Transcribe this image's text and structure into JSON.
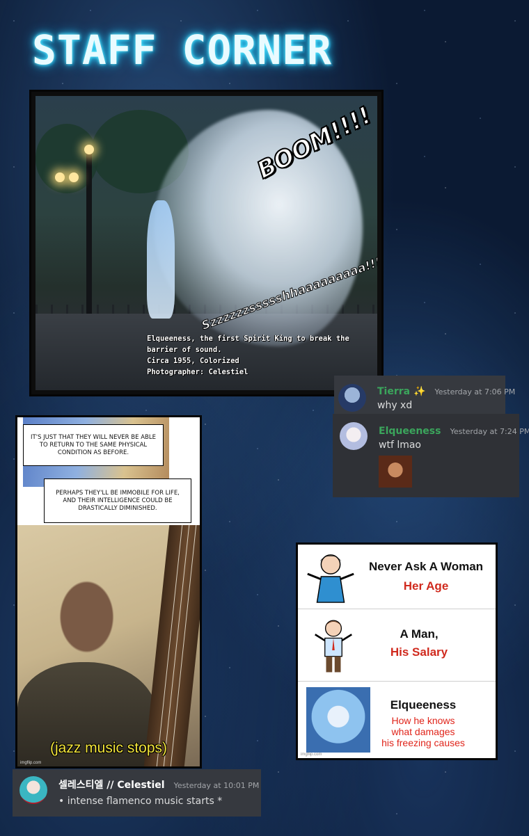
{
  "page": {
    "title": "STAFF CORNER"
  },
  "photo_panel": {
    "sfx_boom": "BOOM!!!!",
    "sfx_whoosh": "Szzzzzzssssshhaaaaaaaaa!!!~",
    "caption_line1": "Elqueeness, the first Spirit King to break the barrier of sound.",
    "caption_line2": "Circa 1955, Colorized",
    "caption_line3": "Photographer: Celestiel"
  },
  "chat_tierra": {
    "username": "Tierra ✨",
    "timestamp": "Yesterday at 7:06 PM",
    "message": "why xd",
    "name_color": "#3ba55c"
  },
  "chat_elqueeness": {
    "username": "Elqueeness",
    "timestamp": "Yesterday at 7:24 PM",
    "message": "wtf lmao",
    "name_color": "#3ba55c",
    "attachment": "laughing-man-image"
  },
  "comic_panel": {
    "bubble1": "IT'S JUST THAT THEY WILL NEVER BE ABLE TO RETURN TO THE SAME PHYSICAL CONDITION AS BEFORE.",
    "bubble2": "PERHAPS THEY'LL BE IMMOBILE FOR LIFE, AND THEIR INTELLIGENCE COULD BE DRASTICALLY DIMINISHED.",
    "jazz_caption": "(jazz music stops)",
    "watermark": "imgflip.com"
  },
  "meme_panel": {
    "row1_line1": "Never Ask A Woman",
    "row1_line2": "Her Age",
    "row2_line1": "A Man,",
    "row2_line2": "His Salary",
    "row3_line1": "Elqueeness",
    "row3_line2": "How he knows",
    "row3_line3": "what damages",
    "row3_line4": "his freezing causes",
    "watermark": "imgflip.com"
  },
  "chat_celestiel": {
    "username": "셀레스티엘 // Celestiel",
    "timestamp": "Yesterday at 10:01 PM",
    "message": "intense flamenco music starts *",
    "name_color": "#ffffff"
  }
}
